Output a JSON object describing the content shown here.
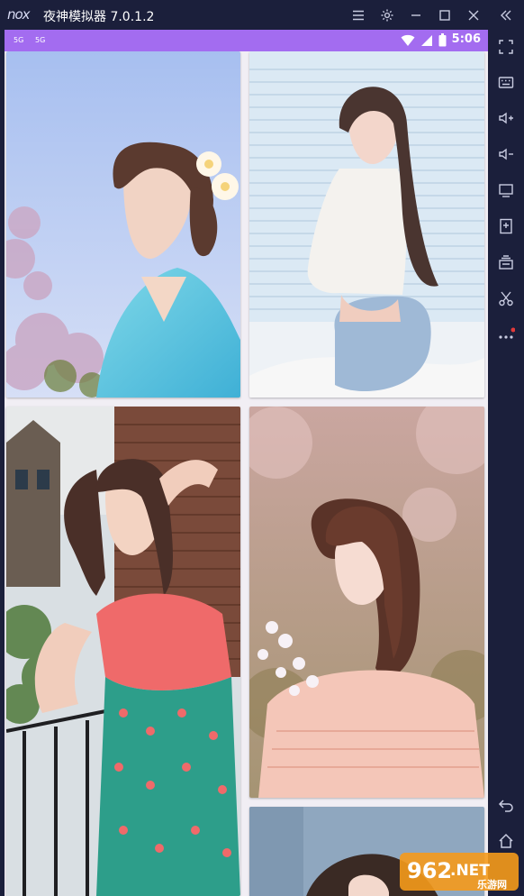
{
  "window": {
    "logo_text": "nox",
    "title": "夜神模拟器 7.0.1.2"
  },
  "statusbar": {
    "signal_1": "5G",
    "signal_2": "5G",
    "time": "5:06"
  },
  "watermark": {
    "brand": "962",
    "suffix": ".NET",
    "sub": "乐游网"
  },
  "colors": {
    "titlebar": "#1b1f3b",
    "statusbar": "#a36cf0",
    "screen_bg": "#f1eef4"
  }
}
